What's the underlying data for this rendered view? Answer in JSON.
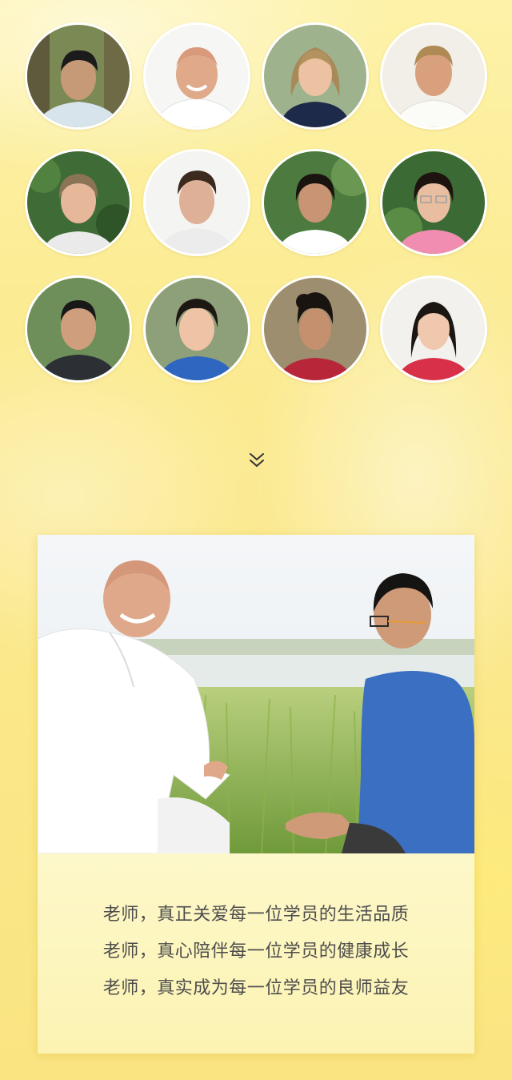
{
  "colors": {
    "background": "#fbe98a",
    "card": "#fdf8cb",
    "caption_text": "#4d4d4d",
    "chevron": "#333333"
  },
  "teachers": [
    {
      "subject": "teacher-portrait-1"
    },
    {
      "subject": "teacher-portrait-2"
    },
    {
      "subject": "teacher-portrait-3"
    },
    {
      "subject": "teacher-portrait-4"
    },
    {
      "subject": "teacher-portrait-5"
    },
    {
      "subject": "teacher-portrait-6"
    },
    {
      "subject": "teacher-portrait-7"
    },
    {
      "subject": "teacher-portrait-8"
    },
    {
      "subject": "teacher-portrait-9"
    },
    {
      "subject": "teacher-portrait-10"
    },
    {
      "subject": "teacher-portrait-11"
    },
    {
      "subject": "teacher-portrait-12"
    }
  ],
  "scroll_icon": "double-chevron-down-icon",
  "captions": [
    "老师，真正关爱每一位学员的生活品质",
    "老师，真心陪伴每一位学员的健康成长",
    "老师，真实成为每一位学员的良师益友"
  ]
}
